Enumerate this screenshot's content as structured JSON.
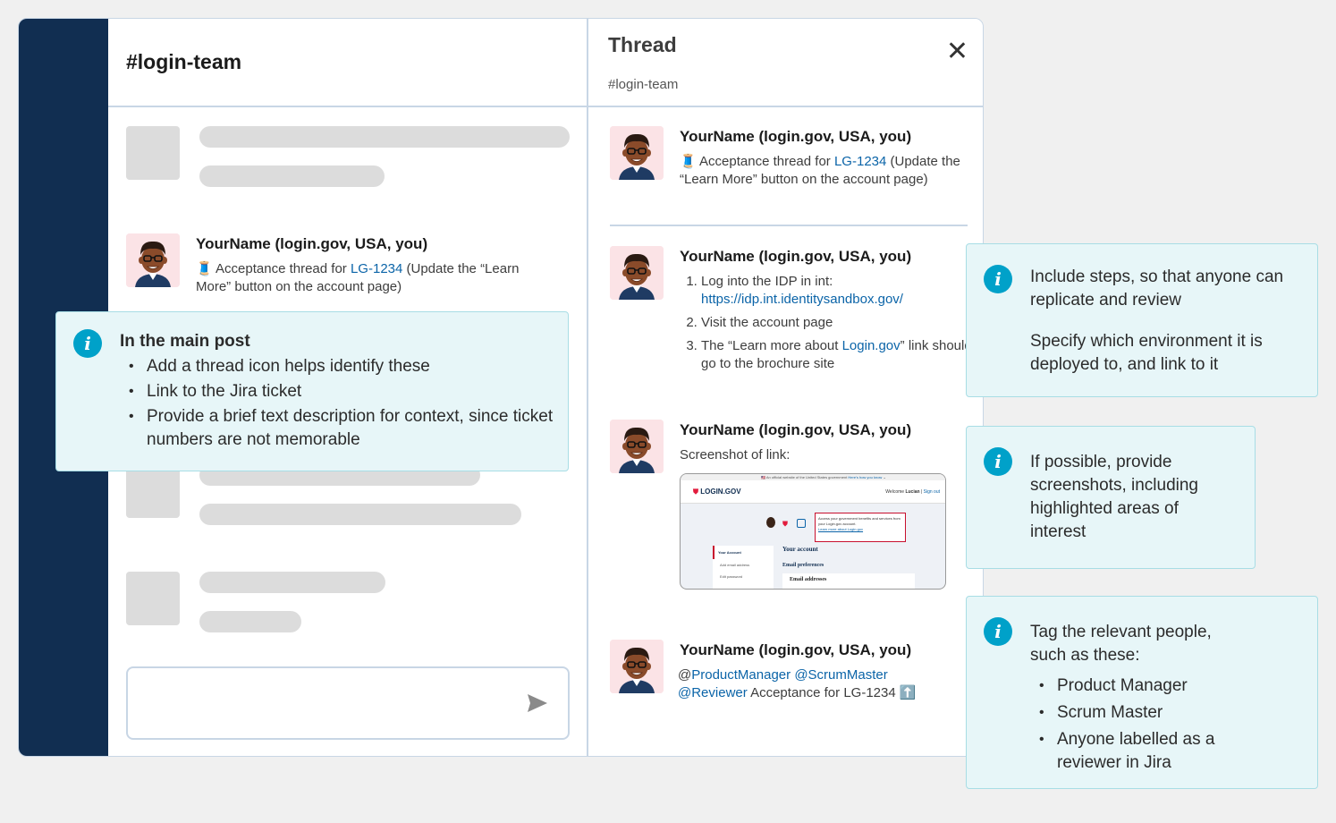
{
  "channel": {
    "title": "#login-team"
  },
  "main_message": {
    "author": "YourName (login.gov, USA, you)",
    "emoji": "🧵",
    "text_before": "Acceptance thread for ",
    "ticket": "LG-1234",
    "text_after": " (Update the “Learn More” button on the account page)"
  },
  "thread": {
    "title": "Thread",
    "subtitle": "#login-team",
    "close_icon": "close-icon",
    "parent": {
      "author": "YourName (login.gov, USA, you)",
      "emoji": "🧵",
      "text_before": "Acceptance thread for ",
      "ticket": "LG-1234",
      "text_after": " (Update the “Learn More” button on the account page)"
    },
    "steps_reply": {
      "author": "YourName (login.gov, USA, you)",
      "step1_text": "Log into the IDP in int:",
      "step1_link": "https://idp.int.identitysandbox.gov/",
      "step2_text": "Visit the account page",
      "step3_before": "The “Learn more about ",
      "step3_link": "Login.gov",
      "step3_after": "” link should go to the brochure site"
    },
    "screenshot_reply": {
      "author": "YourName (login.gov, USA, you)",
      "text": "Screenshot of link:",
      "shot": {
        "banner": "An official website of the United States government",
        "banner_link": "Here's how you know",
        "logo": "LOGIN.GOV",
        "welcome": "Welcome",
        "user": "Lucian",
        "signout": "Sign out",
        "highlight_text": "Access your government benefits and services from your Login.gov account.",
        "highlight_link": "Learn more about Login.gov",
        "nav_active": "Your Account",
        "nav_1": "Add email address",
        "nav_2": "Edit password",
        "heading": "Your account",
        "subheading": "Email preferences",
        "box_label": "Email addresses"
      }
    },
    "tag_reply": {
      "author": "YourName (login.gov, USA, you)",
      "at": "@",
      "mention_1": "ProductManager",
      "mention_2": "@ScrumMaster",
      "mention_3": "@Reviewer",
      "text": " Acceptance for LG-1234",
      "emoji": "⬆️"
    }
  },
  "callouts": {
    "main_post": {
      "title": "In the main post",
      "bullets": [
        "Add a thread icon helps identify these",
        "Link to the Jira ticket",
        "Provide a brief text description for context, since ticket numbers are not memorable"
      ]
    },
    "steps": {
      "line1": "Include steps, so that anyone can replicate and review",
      "line2": "Specify which environment it is deployed to, and link to it"
    },
    "screenshots": {
      "text": "If possible, provide screenshots, including highlighted areas of interest"
    },
    "tags": {
      "intro": "Tag the relevant people, such as these:",
      "bullets": [
        "Product Manager",
        "Scrum Master",
        "Anyone labelled as a reviewer in Jira"
      ]
    }
  },
  "colors": {
    "sidebar": "#112e51",
    "link": "#0b64a8",
    "callout_bg": "#e7f6f8",
    "info_icon": "#00a1c9"
  }
}
